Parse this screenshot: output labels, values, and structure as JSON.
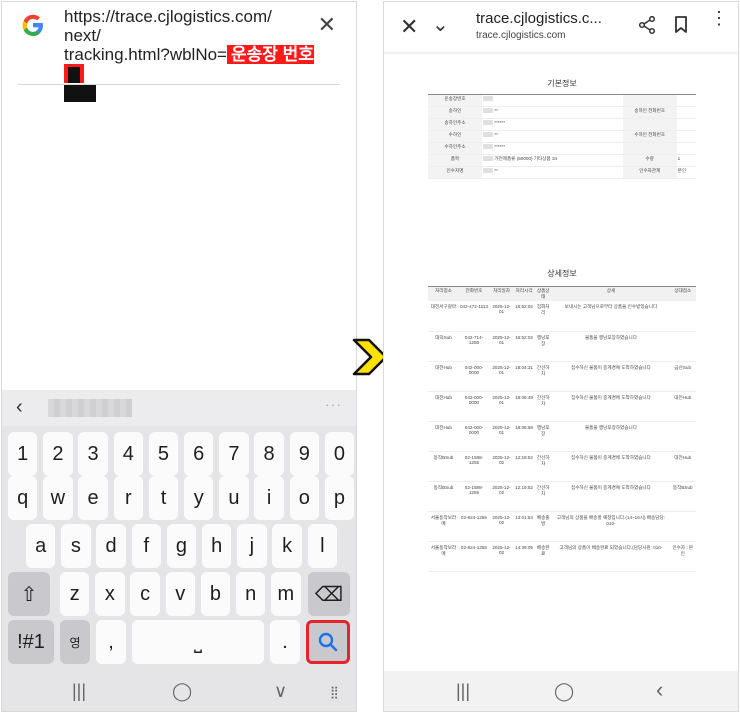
{
  "left": {
    "url_line1": "https://trace.cjlogistics.com/",
    "url_line2": "next/",
    "url_line3": "tracking.html?wblNo=",
    "url_redacted_label": "운송장 번호",
    "close_glyph": "✕",
    "keyboard": {
      "back_glyph": "‹",
      "dots": "···",
      "row_numbers": [
        "1",
        "2",
        "3",
        "4",
        "5",
        "6",
        "7",
        "8",
        "9",
        "0"
      ],
      "row_q": [
        "q",
        "w",
        "e",
        "r",
        "t",
        "y",
        "u",
        "i",
        "o",
        "p"
      ],
      "row_a": [
        "a",
        "s",
        "d",
        "f",
        "g",
        "h",
        "j",
        "k",
        "l"
      ],
      "row_z": [
        "z",
        "x",
        "c",
        "v",
        "b",
        "n",
        "m"
      ],
      "shift_glyph": "⇧",
      "backspace_glyph": "⌫",
      "symbols_label": "!#1",
      "lang_label": "영",
      "lang_top": "한",
      "comma_label": ",",
      "space_glyph": "⎵",
      "period_label": ".",
      "search_glyph": "🔍"
    },
    "nav": {
      "recents": "|||",
      "home": "◯",
      "back": "∨",
      "grid": "⣿"
    }
  },
  "right": {
    "title": "trace.cjlogistics.c...",
    "subtitle": "trace.cjlogistics.com",
    "close_glyph": "✕",
    "chevron_glyph": "⌄",
    "more_glyph": "⋮",
    "basic": {
      "heading": "기본정보",
      "rows": [
        {
          "l1": "운송장번호",
          "v1": "",
          "l2": "",
          "v2": ""
        },
        {
          "l1": "송하인",
          "v1": "**",
          "l2": "송하인 전화번호",
          "v2": ""
        },
        {
          "l1": "송하인주소",
          "v1": "******",
          "l2": "",
          "v2": ""
        },
        {
          "l1": "수하인",
          "v1": "**",
          "l2": "수하인 전화번호",
          "v2": ""
        },
        {
          "l1": "수하인주소",
          "v1": "******",
          "l2": "",
          "v2": ""
        },
        {
          "l1": "품목",
          "v1": "가전제품류 (50000) 기타상품 34",
          "l2": "수량",
          "v2": "1"
        },
        {
          "l1": "인수자명",
          "v1": "**",
          "l2": "인수자관계",
          "v2": "본인"
        }
      ]
    },
    "detail": {
      "heading": "상세정보",
      "headers": [
        "처리점소",
        "전화번호",
        "처리일자",
        "처리시각",
        "상품상태",
        "상세",
        "상대점소"
      ],
      "rows": [
        [
          "대전서구갈마",
          "042-472-1113",
          "2025-12-01",
          "16:52:02",
          "집화처리",
          "보내시는 고객님으로부터 상품을 인수받았습니다",
          ""
        ],
        [
          "대덕Sub",
          "042-714-1255",
          "2025-12-01",
          "16:52:02",
          "행낭포장",
          "물품을 행낭포장하였습니다",
          ""
        ],
        [
          "대전Hub",
          "042-000-0000",
          "2025-12-01",
          "18:04:31",
          "간선하차",
          "집수하신 물품이 중계경에 도착하였습니다",
          "금산Sub"
        ],
        [
          "대전Hub",
          "042-000-0000",
          "2025-12-01",
          "18:06:49",
          "간선하차",
          "집수하신 물품이 중계경에 도착하였습니다",
          "대전Hub"
        ],
        [
          "대전Hub",
          "042-000-0000",
          "2025-12-01",
          "18:06:59",
          "행낭포장",
          "물품을 행낭포장하였습니다",
          ""
        ],
        [
          "동작BSub",
          "02-1588-1255",
          "2025-12-02",
          "12:18:52",
          "간선하차",
          "집수하신 물품이 중계경에 도착하였습니다",
          "대전Hub"
        ],
        [
          "동작BSub",
          "02-1588-1255",
          "2025-12-02",
          "12:19:52",
          "간선하차",
          "집수하신 물품이 중계경에 도착하였습니다",
          "동작BSub"
        ],
        [
          "서울동작보라매",
          "02-824-1255",
          "2025-12-02",
          "13:01:53",
          "배송출발",
          "고객님의 상품을 배송할 예정입니다.(14~16시) 배송담당: 010-",
          ""
        ],
        [
          "서울동작보라매",
          "02-824-1255",
          "2025-12-02",
          "14:39:05",
          "배송완료",
          "고객님의 상품이 배송완료 되었습니다.(담당사원: 010-",
          "인수자 : 본인"
        ]
      ]
    },
    "nav": {
      "recents": "|||",
      "home": "◯",
      "back": "‹"
    }
  },
  "colors": {
    "highlight": "#e4242b",
    "arrow": "#ffe100"
  }
}
